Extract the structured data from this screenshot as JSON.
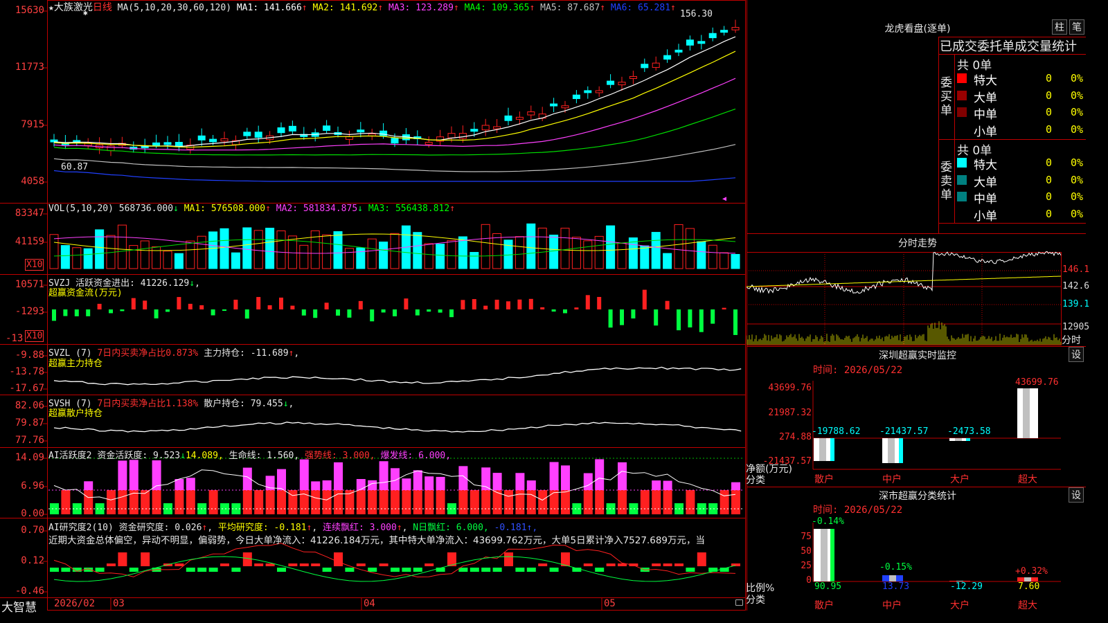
{
  "stock": {
    "name": "大族激光",
    "period": "日线",
    "star_glyph": "★",
    "small_star": "✱"
  },
  "main_chart": {
    "ma_label": "MA(5,10,20,30,60,120)",
    "ma": [
      {
        "label": "MA1: 141.666",
        "arrow": "↑",
        "color": "#ffffff"
      },
      {
        "label": "MA2: 141.692",
        "arrow": "↑",
        "color": "#ffff00"
      },
      {
        "label": "MA3: 123.289",
        "arrow": "↑",
        "color": "#ff40ff"
      },
      {
        "label": "MA4: 109.365",
        "arrow": "↑",
        "color": "#00ff00"
      },
      {
        "label": "MA5: 87.687",
        "arrow": "↑",
        "color": "#c0c0c0"
      },
      {
        "label": "MA6: 65.281",
        "arrow": "↑",
        "color": "#2040ff"
      }
    ],
    "y_labels": [
      "15630",
      "11773",
      "7915",
      "4058"
    ],
    "high_label": "156.30",
    "low_label": "60.87"
  },
  "vol_panel": {
    "title": "VOL(5,10,20)",
    "items": [
      {
        "label": "568736.000",
        "arrow": "↓",
        "color": "#e8e8e8"
      },
      {
        "label": "MA1: 576508.000",
        "arrow": "↑",
        "color": "#ffff00"
      },
      {
        "label": "MA2: 581834.875",
        "arrow": "↓",
        "color": "#ff40ff"
      },
      {
        "label": "MA3: 556438.812",
        "arrow": "↑",
        "color": "#00ff00"
      }
    ],
    "y_labels": [
      "83347",
      "41159"
    ],
    "unit": "X10"
  },
  "svzj_panel": {
    "title": "SVZJ",
    "line1": "活跃资金进出: 41226.129",
    "line1_arrow": "↓",
    "line2": "超赢资金流(万元)",
    "y_labels": [
      "10571",
      "-1293",
      "-13"
    ],
    "unit": "X10"
  },
  "svzl_panel": {
    "title": "SVZL (7)",
    "part1": "7日内买卖净占比0.873%",
    "part2": "主力持仓: -11.689",
    "arrow": "↑",
    "line2": "超赢主力持仓",
    "y_labels": [
      "-9.88",
      "-13.78",
      "-17.67"
    ]
  },
  "svsh_panel": {
    "title": "SVSH (7)",
    "part1": "7日内买卖净占比1.138%",
    "part2": "散户持仓: 79.455",
    "arrow": "↓",
    "line2": "超赢散户持仓",
    "y_labels": [
      "82.06",
      "79.87",
      "77.76"
    ]
  },
  "ai_active_panel": {
    "title": "AI活跃度2",
    "part1": "资金活跃度: 9.523",
    "part1_arrow": "↓",
    "part2": "14.089,",
    "part3": "生命线: 1.560,",
    "part4": "强势线: 3.000,",
    "part5": "爆发线: 6.000,",
    "y_labels": [
      "14.09",
      "6.96",
      "0.00"
    ]
  },
  "ai_research_panel": {
    "title": "AI研究度2(10)",
    "part1": "资金研究度: 0.026",
    "part1_arrow": "↑",
    "part2": "平均研究度: -0.181",
    "part2_arrow": "↑",
    "part3": "连续飘红: 3.000",
    "part3_arrow": "↑",
    "part4": "N日飘红: 6.000,",
    "part5": "-0.181",
    "part5_arrow": "↑",
    "commentary": "近期大资金总体偏空，异动不明显，偏弱势，今日大单净流入：41226.184万元，其中特大单净流入：43699.762万元，大单5日累计净入7527.689万元，当",
    "y_labels": [
      "0.70",
      "0.12",
      "-0.46"
    ]
  },
  "date_axis": [
    "2026/02",
    "03",
    "04",
    "05"
  ],
  "brand": "大智慧",
  "lhb": {
    "title": "龙虎看盘(逐单)",
    "buttons": [
      "柱",
      "笔"
    ],
    "header": "已成交委托单成交量统计",
    "buy": {
      "side_label": "委买单",
      "total": "共 0单",
      "rows": [
        {
          "label": "特大",
          "count": "0",
          "pct": "0%",
          "color": "#ff0000"
        },
        {
          "label": "大单",
          "count": "0",
          "pct": "0%",
          "color": "#990000"
        },
        {
          "label": "中单",
          "count": "0",
          "pct": "0%",
          "color": "#800000"
        },
        {
          "label": "小单",
          "count": "0",
          "pct": "0%",
          "color": ""
        }
      ]
    },
    "sell": {
      "side_label": "委卖单",
      "total": "共 0单",
      "rows": [
        {
          "label": "特大",
          "count": "0",
          "pct": "0%",
          "color": "#00ffff"
        },
        {
          "label": "大单",
          "count": "0",
          "pct": "0%",
          "color": "#008080"
        },
        {
          "label": "中单",
          "count": "0",
          "pct": "0%",
          "color": "#008080"
        },
        {
          "label": "小单",
          "count": "0",
          "pct": "0%",
          "color": ""
        }
      ]
    }
  },
  "intraday": {
    "title": "分时走势",
    "y_labels": [
      "146.1",
      "142.6",
      "139.1",
      "12905"
    ],
    "unit": "分时"
  },
  "monitor": {
    "title": "深圳超赢实时监控",
    "set_label": "设",
    "time": "时间: 2026/05/22",
    "y_labels": [
      "43699.76",
      "21987.32",
      "274.88",
      "-21437.57"
    ],
    "axis_title1": "净额(万元)",
    "axis_title2": "分类",
    "categories": [
      "散户",
      "中户",
      "大户",
      "超大"
    ],
    "values_text": [
      "-19788.62",
      "-21437.57",
      "-2473.58",
      "43699.76"
    ]
  },
  "classify": {
    "title": "深市超赢分类统计",
    "set_label": "设",
    "time": "时间: 2026/05/22",
    "y_labels": [
      "75",
      "50",
      "25",
      "0"
    ],
    "axis_title1": "比例%",
    "axis_title2": "分类",
    "categories": [
      "散户",
      "中户",
      "大户",
      "超大"
    ],
    "top_text": [
      "-0.14%",
      "-0.15%",
      "",
      "+0.32%"
    ],
    "bottom_text": [
      "90.95",
      "13.73",
      "-12.29",
      "7.60"
    ]
  },
  "colors": {
    "up": "#ff2020",
    "down": "#00ffff",
    "grid": "#c00000",
    "bg": "#000000"
  }
}
